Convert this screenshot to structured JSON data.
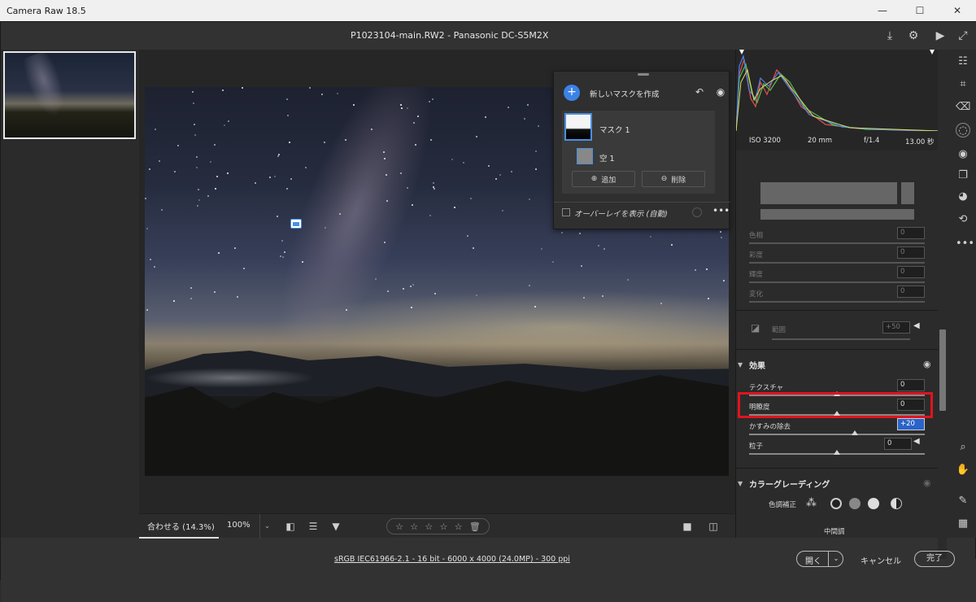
{
  "window": {
    "title": "Camera Raw 18.5",
    "minimize": "—",
    "maximize": "☐",
    "close": "✕"
  },
  "header": {
    "filename": "P1023104-main.RW2  -  Panasonic DC-S5M2X"
  },
  "bottombar": {
    "zoom_fit": "合わせる (14.3%)",
    "zoom_100": "100%",
    "rating": [
      "☆",
      "☆",
      "☆",
      "☆",
      "☆"
    ]
  },
  "mask_panel": {
    "new_mask": "新しいマスクを作成",
    "mask_name": "マスク 1",
    "sub_name": "空 1",
    "add": "追加",
    "delete": "削除",
    "overlay": "オーバーレイを表示 (自動)"
  },
  "histogram_info": {
    "iso": "ISO 3200",
    "focal": "20 mm",
    "aperture": "f/1.4",
    "shutter": "13.00 秒"
  },
  "sliders_top": [
    {
      "label": "色相",
      "value": "0"
    },
    {
      "label": "彩度",
      "value": "0"
    },
    {
      "label": "輝度",
      "value": "0"
    },
    {
      "label": "変化",
      "value": "0"
    }
  ],
  "range": {
    "label": "範囲",
    "value": "+50"
  },
  "effects": {
    "header": "効果",
    "sliders": [
      {
        "label": "テクスチャ",
        "value": "0",
        "pos": 0.5
      },
      {
        "label": "明瞭度",
        "value": "0",
        "pos": 0.5
      },
      {
        "label": "かすみの除去",
        "value": "+20",
        "pos": 0.6
      },
      {
        "label": "粒子",
        "value": "0",
        "pos": 0.5
      }
    ]
  },
  "color_grading": {
    "header": "カラーグレーディング",
    "adjust_label": "色調補正",
    "midtones": "中間調"
  },
  "footer": {
    "info": "sRGB IEC61966-2.1 - 16 bit - 6000 x 4000 (24.0MP) - 300 ppi",
    "open": "開く",
    "cancel": "キャンセル",
    "done": "完了"
  }
}
